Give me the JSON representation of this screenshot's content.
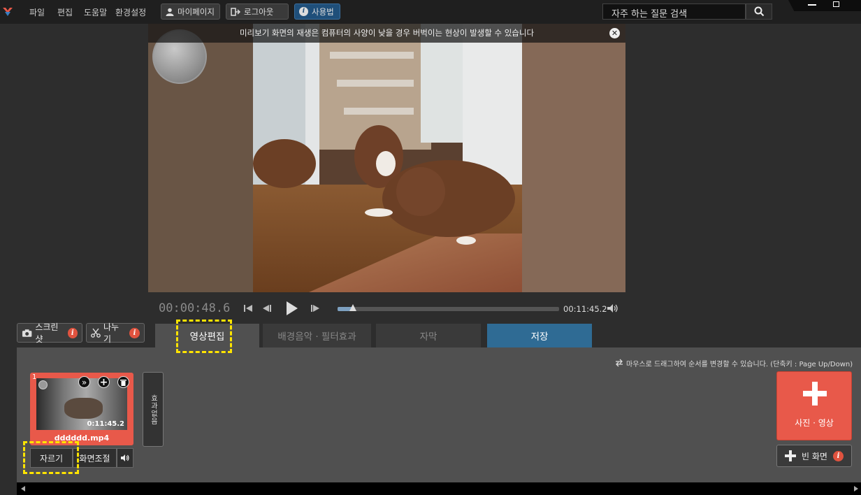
{
  "menu": [
    "파일",
    "편집",
    "도움말",
    "환경설정"
  ],
  "top_buttons": {
    "mypage": "마이페이지",
    "logout": "로그아웃",
    "howto": "사용법"
  },
  "search": {
    "value": "자주 하는 질문 검색"
  },
  "preview": {
    "notice": "미리보기 화면의 재생은 컴퓨터의 사양이 낮을 경우 버벅이는 현상이 발생할 수 있습니다"
  },
  "playback": {
    "current_time": "00:00:48.6",
    "duration": "00:11:45.2",
    "progress": 0.07
  },
  "tools": {
    "screenshot": "스크린샷",
    "split": "나누기"
  },
  "tabs": {
    "video_edit": "영상편집",
    "bgm_filter": "배경음악 · 필터효과",
    "subtitle": "자막",
    "save": "저장"
  },
  "hint": "마우스로 드래그하여 순서를 변경할 수 있습니다.  (단축키 : Page Up/Down)",
  "clip": {
    "index": "1",
    "time": "0:11:45.2",
    "filename": "dddddd.mp4",
    "trim": "자르기",
    "screen_adjust": "화면조절"
  },
  "effect": {
    "label": "효과없음"
  },
  "add": {
    "media": "사진 · 영상",
    "blank": "빈 화면"
  },
  "colors": {
    "accent_red": "#e8594a",
    "save_blue": "#2f6b94",
    "highlight": "#ffe400"
  }
}
